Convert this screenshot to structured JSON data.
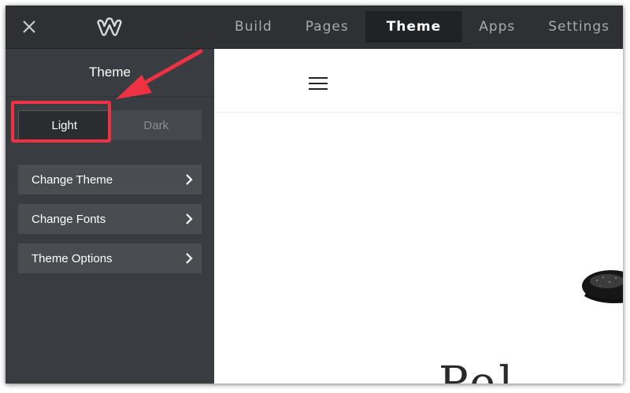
{
  "topbar": {
    "close_icon": "close-icon",
    "logo_icon": "weebly-logo-icon",
    "tabs": [
      {
        "label": "Build",
        "active": false
      },
      {
        "label": "Pages",
        "active": false
      },
      {
        "label": "Theme",
        "active": true
      },
      {
        "label": "Apps",
        "active": false
      },
      {
        "label": "Settings",
        "active": false
      }
    ]
  },
  "sidebar": {
    "title": "Theme",
    "mode_toggle": {
      "light_label": "Light",
      "dark_label": "Dark",
      "selected": "Light"
    },
    "items": [
      {
        "label": "Change Theme",
        "icon": "chevron-right-icon"
      },
      {
        "label": "Change Fonts",
        "icon": "chevron-right-icon"
      },
      {
        "label": "Theme Options",
        "icon": "chevron-right-icon"
      }
    ]
  },
  "preview": {
    "menu_icon": "hamburger-menu-icon",
    "hero_text": "Pel"
  },
  "annotation": {
    "color": "#ee3243"
  },
  "colors": {
    "topbar": "#2e3033",
    "sidebar": "#393c40",
    "menu_item": "#494c50",
    "accent_annotation": "#ee3243"
  }
}
